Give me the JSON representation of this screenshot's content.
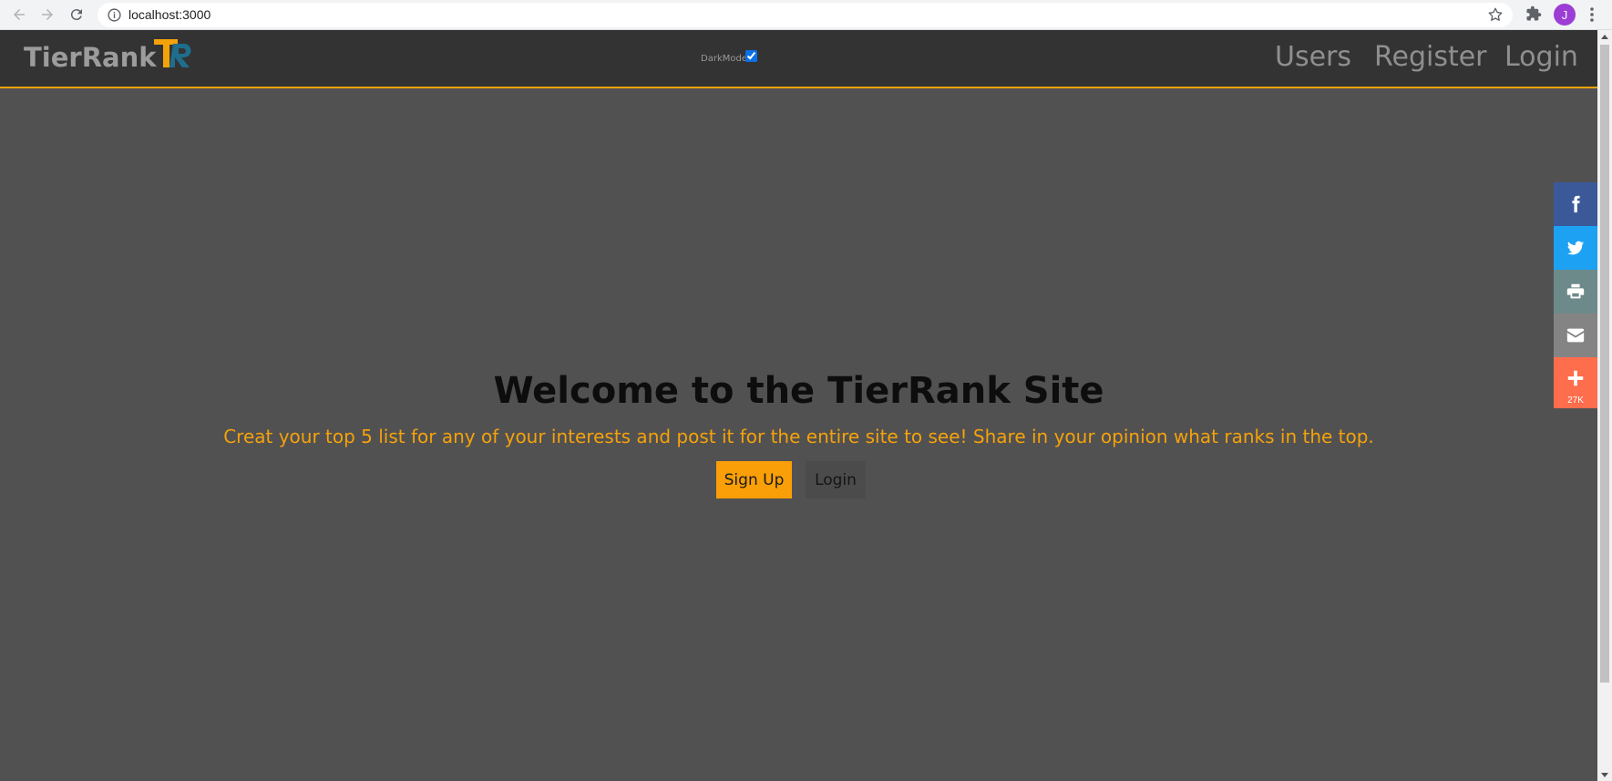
{
  "browser": {
    "url": "localhost:3000",
    "avatar_initial": "J"
  },
  "header": {
    "brand": "TierRank",
    "logo_text": "TR",
    "darkmode_label": "DarkMode",
    "darkmode_checked": true,
    "nav": [
      "Users",
      "Register",
      "Login"
    ]
  },
  "hero": {
    "title": "Welcome to the TierRank Site",
    "subtitle": "Creat your top 5 list for any of your interests and post it for the entire site to see! Share in your opinion what ranks in the top.",
    "signup_label": "Sign Up",
    "login_label": "Login"
  },
  "share": {
    "items": [
      {
        "name": "facebook",
        "icon": "facebook-icon",
        "color": "#3b5998"
      },
      {
        "name": "twitter",
        "icon": "twitter-icon",
        "color": "#1da1f2"
      },
      {
        "name": "print",
        "icon": "print-icon",
        "color": "#6d8a8a"
      },
      {
        "name": "email",
        "icon": "email-icon",
        "color": "#848484"
      },
      {
        "name": "more",
        "icon": "plus-icon",
        "color": "#fe6d4c"
      }
    ],
    "count": "27K"
  },
  "colors": {
    "accent": "#f4a20a",
    "background": "#525152",
    "header": "#333333"
  }
}
